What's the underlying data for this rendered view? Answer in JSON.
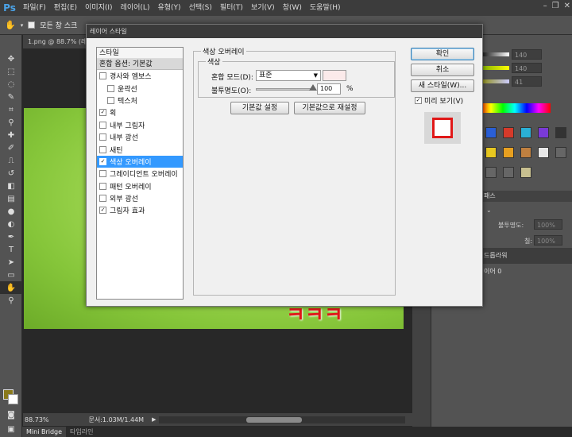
{
  "app": {
    "logo": "Ps",
    "menu": [
      "파일(F)",
      "편집(E)",
      "이미지(I)",
      "레이어(L)",
      "유형(Y)",
      "선택(S)",
      "필터(T)",
      "보기(V)",
      "창(W)",
      "도움말(H)"
    ]
  },
  "options_bar": {
    "label": "모든 창 스크"
  },
  "document": {
    "tab": "1.png @ 88.7% (레",
    "zoom": "88.73%",
    "doc_size": "문서:1.03M/1.44M",
    "canvas_text": "ㅋㅋㅋ"
  },
  "bottom_tabs": [
    "Mini Bridge",
    "타임라인"
  ],
  "color_panel": {
    "values": [
      "140",
      "140",
      "41"
    ]
  },
  "layers_panel": {
    "tab": "패스",
    "opacity_label": "불투명도:",
    "opacity_value": "100%",
    "fill_label": "칠:",
    "fill_value": "100%",
    "rows": [
      "드롭라워",
      "이어 0"
    ]
  },
  "dialog": {
    "title": "레이어 스타일",
    "styles_header": "스타일",
    "blend_options": "혼합 옵션: 기본값",
    "items": [
      {
        "label": "경사와 엠보스",
        "checked": false,
        "sub": false,
        "selected": false
      },
      {
        "label": "윤곽선",
        "checked": false,
        "sub": true,
        "selected": false
      },
      {
        "label": "텍스처",
        "checked": false,
        "sub": true,
        "selected": false
      },
      {
        "label": "획",
        "checked": true,
        "sub": false,
        "selected": false
      },
      {
        "label": "내부 그림자",
        "checked": false,
        "sub": false,
        "selected": false
      },
      {
        "label": "내부 광선",
        "checked": false,
        "sub": false,
        "selected": false
      },
      {
        "label": "새틴",
        "checked": false,
        "sub": false,
        "selected": false
      },
      {
        "label": "색상 오버레이",
        "checked": true,
        "sub": false,
        "selected": true
      },
      {
        "label": "그레이디언트 오버레이",
        "checked": false,
        "sub": false,
        "selected": false
      },
      {
        "label": "패턴 오버레이",
        "checked": false,
        "sub": false,
        "selected": false
      },
      {
        "label": "외부 광선",
        "checked": false,
        "sub": false,
        "selected": false
      },
      {
        "label": "그림자 효과",
        "checked": true,
        "sub": false,
        "selected": false
      }
    ],
    "section_title": "색상 오버레이",
    "group_title": "색상",
    "blend_mode_label": "혼합 모드(D):",
    "blend_mode_value": "표준",
    "opacity_label": "불투명도(O):",
    "opacity_value": "100",
    "percent": "%",
    "set_default": "기본값 설정",
    "reset_default": "기본값으로 재설정",
    "ok": "확인",
    "cancel": "취소",
    "new_style": "새 스타일(W)...",
    "preview_label": "미리 보기(V)",
    "preview_checked": true
  }
}
